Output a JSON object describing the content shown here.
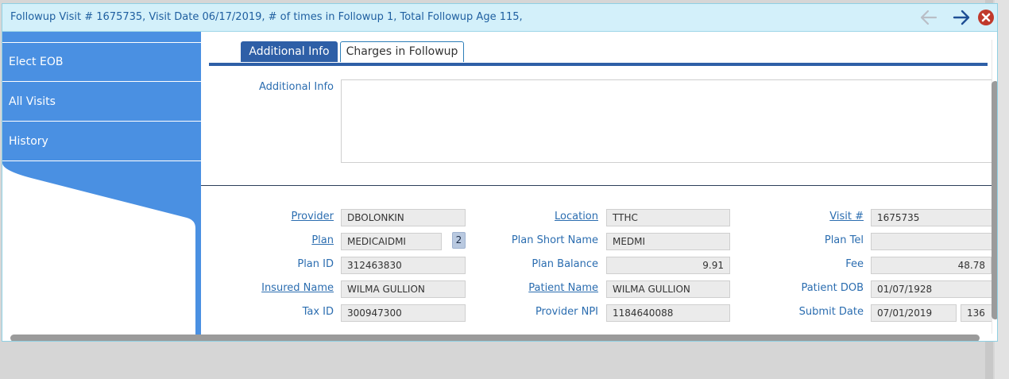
{
  "window": {
    "title": "Followup Visit # 1675735, Visit Date 06/17/2019, # of times in Followup 1, Total Followup Age 115,",
    "back_icon": "arrow-left-icon",
    "forward_icon": "arrow-right-icon",
    "close_icon": "close-circle-icon",
    "colors": {
      "title_bg": "#d3f0fa",
      "accent": "#2e5fa7",
      "sidebar": "#4a90e2",
      "close": "#c0392b"
    }
  },
  "sidebar": {
    "items": [
      {
        "label": "Elect EOB"
      },
      {
        "label": "All Visits"
      },
      {
        "label": "History"
      }
    ]
  },
  "tabs": [
    {
      "label": "Additional Info",
      "active": true
    },
    {
      "label": "Charges in Followup",
      "active": false
    }
  ],
  "additional_info": {
    "label": "Additional Info",
    "value": ""
  },
  "fields": {
    "provider": {
      "label": "Provider",
      "value": "DBOLONKIN"
    },
    "plan": {
      "label": "Plan",
      "value": "MEDICAIDMI",
      "badge": "2"
    },
    "plan_id": {
      "label": "Plan ID",
      "value": "312463830"
    },
    "insured_name": {
      "label": "Insured Name",
      "value": "WILMA  GULLION"
    },
    "tax_id": {
      "label": "Tax ID",
      "value": "300947300"
    },
    "location": {
      "label": "Location",
      "value": "TTHC"
    },
    "plan_short_name": {
      "label": "Plan Short Name",
      "value": "MEDMI"
    },
    "plan_balance": {
      "label": "Plan Balance",
      "value": "9.91"
    },
    "patient_name": {
      "label": "Patient Name",
      "value": "WILMA  GULLION"
    },
    "provider_npi": {
      "label": "Provider NPI",
      "value": "1184640088"
    },
    "visit_num": {
      "label": "Visit #",
      "value": "1675735"
    },
    "plan_tel": {
      "label": "Plan Tel",
      "value": ""
    },
    "fee": {
      "label": "Fee",
      "value": "48.78"
    },
    "patient_dob": {
      "label": "Patient DOB",
      "value": "01/07/1928"
    },
    "submit_date": {
      "label": "Submit Date",
      "value": "07/01/2019",
      "days": "136"
    }
  }
}
